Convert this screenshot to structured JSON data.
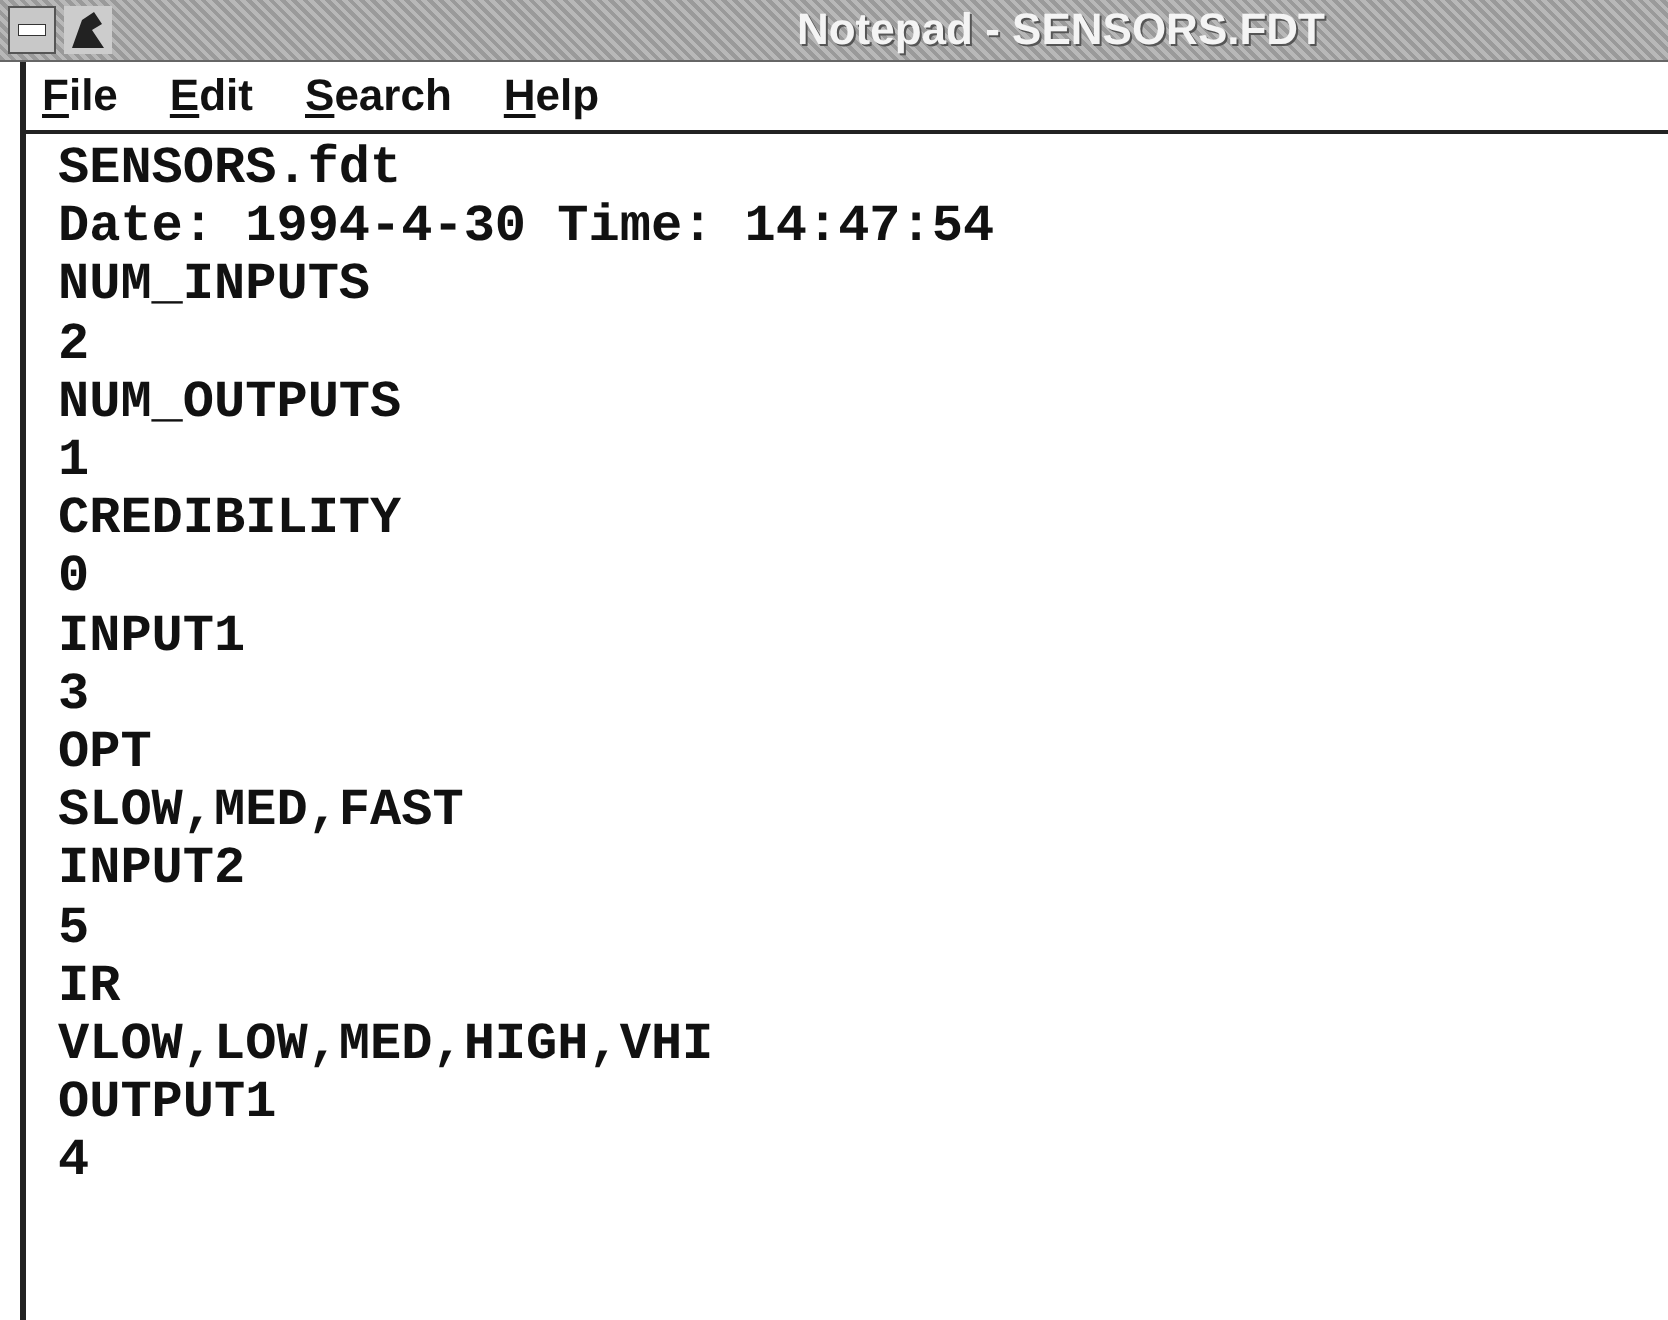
{
  "window": {
    "title": "Notepad - SENSORS.FDT"
  },
  "menu": [
    {
      "label": "File"
    },
    {
      "label": "Edit"
    },
    {
      "label": "Search"
    },
    {
      "label": "Help"
    }
  ],
  "document": {
    "lines": [
      "SENSORS.fdt",
      "Date: 1994-4-30 Time: 14:47:54",
      "NUM_INPUTS",
      "2",
      "NUM_OUTPUTS",
      "1",
      "CREDIBILITY",
      "0",
      "INPUT1",
      "3",
      "OPT",
      "SLOW,MED,FAST",
      "INPUT2",
      "5",
      "IR",
      "VLOW,LOW,MED,HIGH,VHI",
      "OUTPUT1",
      "4"
    ]
  }
}
